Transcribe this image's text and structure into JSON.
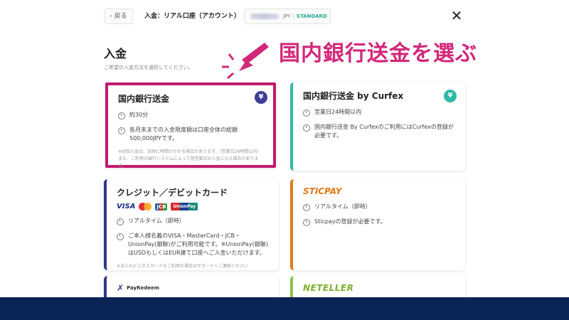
{
  "header": {
    "back_label": "戻る",
    "breadcrumb": "入金：リアル口座（アカウント）",
    "account_type": "JPY",
    "account_plan": "STANDARD"
  },
  "page": {
    "title": "入金",
    "subtitle": "ご希望の入金方法を選択してください。"
  },
  "callout": {
    "text": "国内銀行送金を選ぶ",
    "color": "#d2287a"
  },
  "methods": [
    {
      "title": "国内銀行送金",
      "badge": "¥",
      "time": "約30分",
      "detail": "各月末までの入金限度額は口座全体の総額500,000JPYです。",
      "note": "※初回入金は、反映に時間がかかる場合があります。（営業日24時間以内）また、ご利用の銀行システムによって翌営業日の入金になる場合があります。"
    },
    {
      "title": "国内銀行送金 by Curfex",
      "badge": "¥",
      "time": "営業日24時間以内",
      "detail": "国内銀行送金 By Curfexのご利用にはCurfexの登録が必要です。"
    },
    {
      "title": "クレジット／デビットカード",
      "logos": [
        "VISA",
        "mastercard",
        "JCB",
        "UnionPay"
      ],
      "time": "リアルタイム（即時）",
      "detail": "ご本人様名義のVISA・MasterCard・JCB・UnionPay(銀聯)がご利用可能です。※UnionPay(銀聯)はUSDもしくはEUR建て口座へご入金いただけます。",
      "note": "※法人のビジネスカードをご利用の場合はサポートへご連絡ください"
    },
    {
      "logo": "STICPAY",
      "time": "リアルタイム（即時）",
      "detail": "Sticpayの登録が必要です。"
    },
    {
      "logo": "PayRedeem"
    },
    {
      "logo": "NETELLER"
    }
  ],
  "colors": {
    "highlight": "#c21a6e",
    "footer": "#0b2456"
  }
}
